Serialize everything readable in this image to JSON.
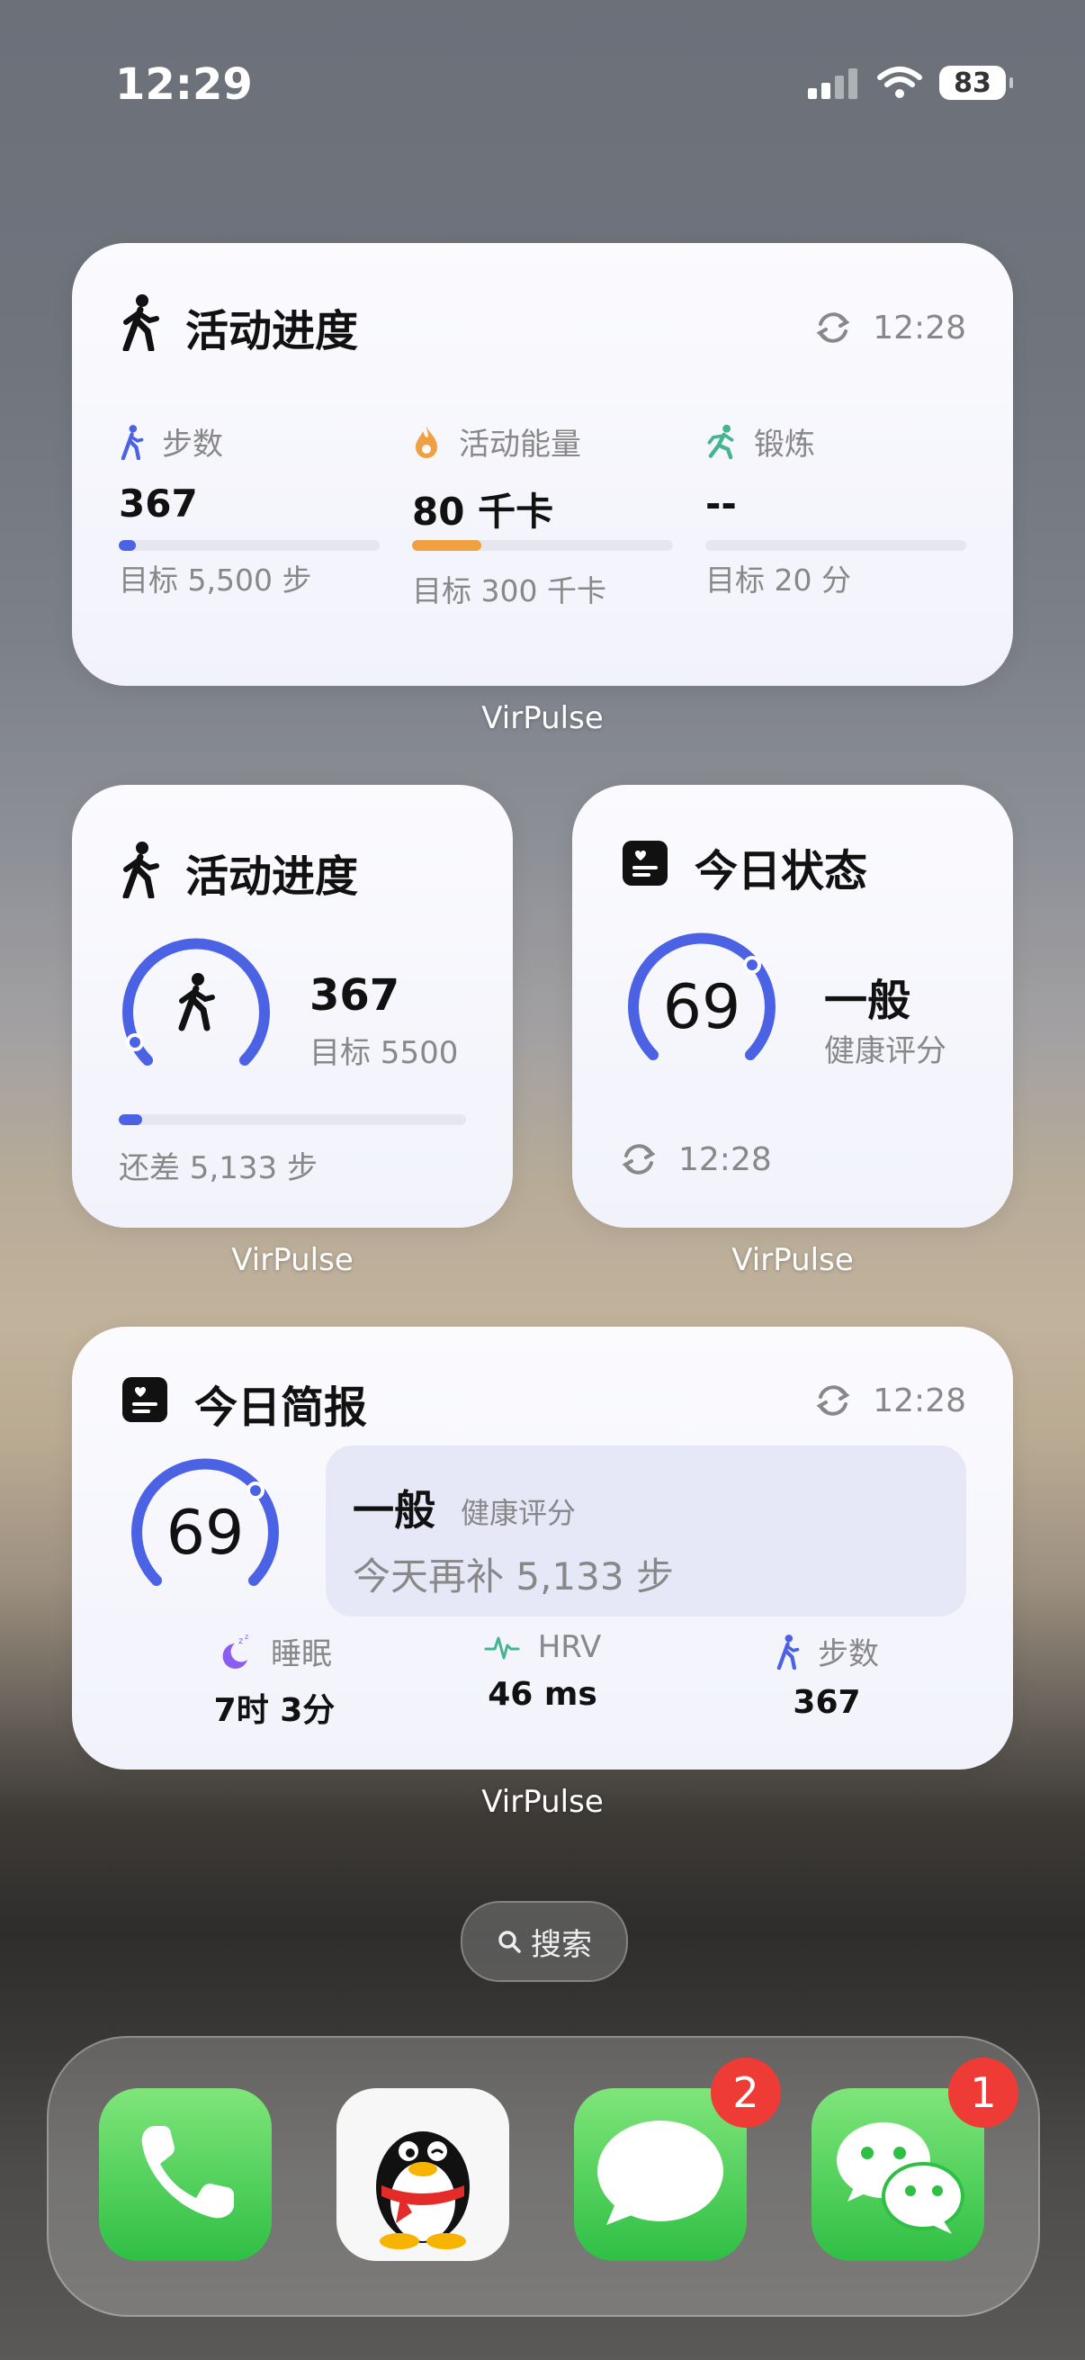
{
  "status_bar": {
    "time": "12:29",
    "battery": "83"
  },
  "widget_large": {
    "title": "活动进度",
    "refresh_time": "12:28",
    "metrics": [
      {
        "label": "步数",
        "value": "367",
        "goal": "目标 5,500 步",
        "progress": 0.067,
        "color": "#4c62e5"
      },
      {
        "label": "活动能量",
        "value": "80 千卡",
        "goal": "目标 300 千卡",
        "progress": 0.267,
        "color": "#f0a040"
      },
      {
        "label": "锻炼",
        "value": "--",
        "goal": "目标 20 分",
        "progress": 0,
        "color": "#44b58f"
      }
    ],
    "app_label": "VirPulse"
  },
  "widget_small_activity": {
    "title": "活动进度",
    "value": "367",
    "goal": "目标 5500",
    "remaining": "还差 5,133 步",
    "progress": 0.067,
    "app_label": "VirPulse"
  },
  "widget_small_status": {
    "title": "今日状态",
    "score": "69",
    "rating": "一般",
    "rating_sub": "健康评分",
    "refresh_time": "12:28",
    "app_label": "VirPulse"
  },
  "widget_brief": {
    "title": "今日简报",
    "refresh_time": "12:28",
    "score": "69",
    "rating": "一般",
    "rating_sub": "健康评分",
    "suggestion": "今天再补 5,133 步",
    "stats": [
      {
        "label": "睡眠",
        "value": "7时 3分"
      },
      {
        "label": "HRV",
        "value": "46 ms"
      },
      {
        "label": "步数",
        "value": "367"
      }
    ],
    "app_label": "VirPulse"
  },
  "search": {
    "label": "搜索"
  },
  "dock": {
    "apps": [
      {
        "name": "phone",
        "badge": ""
      },
      {
        "name": "qq",
        "badge": ""
      },
      {
        "name": "messages",
        "badge": "2"
      },
      {
        "name": "wechat",
        "badge": "1"
      }
    ]
  },
  "colors": {
    "accent": "#4c62e5",
    "orange": "#f0a040",
    "green": "#44b58f",
    "purple": "#8a5cf0"
  }
}
